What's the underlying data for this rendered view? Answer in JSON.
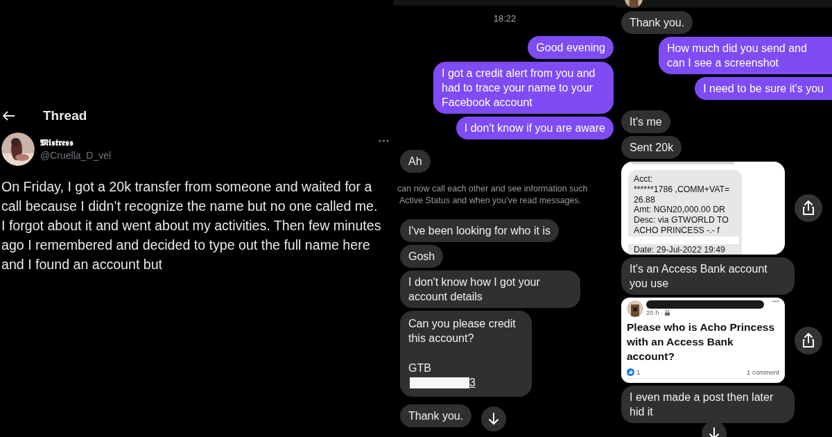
{
  "thread": {
    "title": "Thread",
    "author": {
      "name": "𝕸𝖎𝖘𝖙𝖗𝖊𝖘𝖘",
      "handle": "@Cruella_D_vel"
    },
    "paragraphs": [
      "On Friday, I got a 20k transfer from someone and waited for a call because I didn’t recognize the name but no one called me.",
      "I forgot about it and went about my activities. Then few minutes ago I remembered and decided to type out the full name here and I found an account but"
    ]
  },
  "chat_left": {
    "time": "18:22",
    "messages": [
      {
        "kind": "out",
        "text": "Good evening"
      },
      {
        "kind": "out",
        "text": "I got a credit alert from you and had to trace your name to your Facebook account"
      },
      {
        "kind": "out",
        "text": "I don't know if you are aware"
      },
      {
        "kind": "in",
        "text": "Ah"
      },
      {
        "kind": "notice",
        "lines": [
          "can now call each other and see information such",
          "Active Status and when you've read messages."
        ]
      },
      {
        "kind": "in",
        "text": "I've been looking for who it is"
      },
      {
        "kind": "in",
        "text": "Gosh"
      },
      {
        "kind": "in",
        "text": "I don't know how I got your account details"
      },
      {
        "kind": "account",
        "lines": [
          "Can you please credit",
          "this account?"
        ],
        "bank": "GTB",
        "masked_tail": "3"
      },
      {
        "kind": "in",
        "text": "Thank you."
      }
    ]
  },
  "chat_right": {
    "messages": [
      {
        "kind": "in",
        "text": "Thank you."
      },
      {
        "kind": "out",
        "text": "How much did you send and can I see a screenshot"
      },
      {
        "kind": "out",
        "text": "I need to be sure it's you"
      },
      {
        "kind": "in",
        "text": "It's me"
      },
      {
        "kind": "in",
        "text": "Sent 20k"
      },
      {
        "kind": "receipt",
        "lines": [
          "Acct:",
          "******1786 ,COMM+VAT=",
          "26.88",
          "Amt: NGN20,000.00 DR",
          "Desc: via GTWORLD TO",
          "ACHO PRINCESS -.- f"
        ],
        "date": "Date: 29-Jul-2022 19:49"
      },
      {
        "kind": "in",
        "text": "It's an Access Bank account you use"
      },
      {
        "kind": "post",
        "time": "20 h ·",
        "text": "Please who is Acho Princess with an Access Bank account?",
        "likes": "1",
        "comments": "1 comment"
      },
      {
        "kind": "in",
        "text": "I even made a post then later hid it"
      }
    ]
  }
}
